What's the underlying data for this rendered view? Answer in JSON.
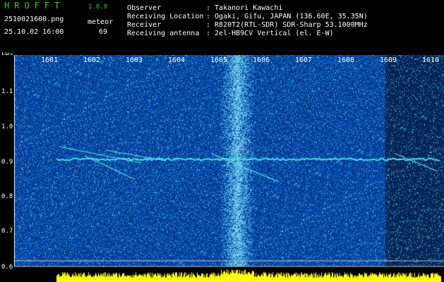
{
  "header": {
    "logo": "HROFFT",
    "version": "1.0.0",
    "filename": "2510021600.png",
    "datetime": "25.10.02 16:00",
    "mode_label": "meteor",
    "count": "69",
    "fields": [
      {
        "label": "Observer",
        "value": ": Takanori Kawachi"
      },
      {
        "label": "Receiving Location",
        "value": ": Ogaki, Gifu, JAPAN (136.60E, 35.35N)"
      },
      {
        "label": "Receiver",
        "value": ": R820T2(RTL-SDR) SDR-Sharp 53.1000MHz"
      },
      {
        "label": "Receiving antenna",
        "value": ": 2el-HB9CV Vertical (el. E-W)"
      }
    ]
  },
  "axes": {
    "y_unit": "kHz",
    "y_ticks": [
      "1.1",
      "1.0",
      "0.9",
      "0.8",
      "0.7",
      "0.6"
    ],
    "x_ticks": [
      "1601",
      "1602",
      "1603",
      "1604",
      "1605",
      "1606",
      "1607",
      "1608",
      "1609",
      "1610"
    ]
  },
  "colors": {
    "background_low": "#0a1a7a",
    "trace": "#40e0e0",
    "amplitude": "#ffff00"
  }
}
